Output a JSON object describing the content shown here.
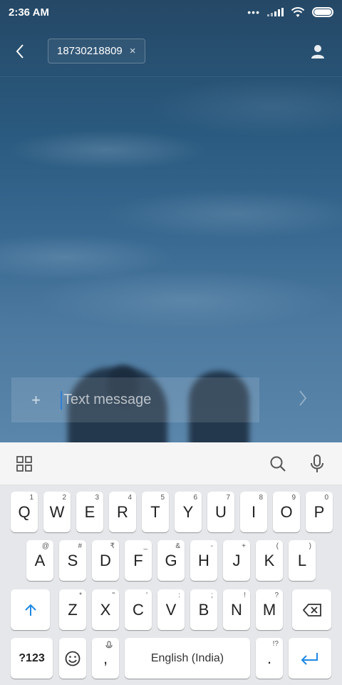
{
  "status_bar": {
    "time": "2:36 AM",
    "dots": "•••"
  },
  "header": {
    "recipient": "18730218809",
    "remove_symbol": "×"
  },
  "compose": {
    "attach_symbol": "+",
    "placeholder": "Text message"
  },
  "colors": {
    "accent": "#2f7fd6",
    "keyboard_bg": "#e5e7ea",
    "toolbar_bg": "#f5f5f5"
  },
  "keyboard": {
    "row1": [
      {
        "label": "Q",
        "alt": "1"
      },
      {
        "label": "W",
        "alt": "2"
      },
      {
        "label": "E",
        "alt": "3"
      },
      {
        "label": "R",
        "alt": "4"
      },
      {
        "label": "T",
        "alt": "5"
      },
      {
        "label": "Y",
        "alt": "6"
      },
      {
        "label": "U",
        "alt": "7"
      },
      {
        "label": "I",
        "alt": "8"
      },
      {
        "label": "O",
        "alt": "9"
      },
      {
        "label": "P",
        "alt": "0"
      }
    ],
    "row2": [
      {
        "label": "A",
        "alt": "@"
      },
      {
        "label": "S",
        "alt": "#"
      },
      {
        "label": "D",
        "alt": "₹"
      },
      {
        "label": "F",
        "alt": "_"
      },
      {
        "label": "G",
        "alt": "&"
      },
      {
        "label": "H",
        "alt": "-"
      },
      {
        "label": "J",
        "alt": "+"
      },
      {
        "label": "K",
        "alt": "("
      },
      {
        "label": "L",
        "alt": ")"
      }
    ],
    "row3": [
      {
        "label": "Z",
        "alt": "*"
      },
      {
        "label": "X",
        "alt": "\""
      },
      {
        "label": "C",
        "alt": "'"
      },
      {
        "label": "V",
        "alt": ":"
      },
      {
        "label": "B",
        "alt": ";"
      },
      {
        "label": "N",
        "alt": "!"
      },
      {
        "label": "M",
        "alt": "?"
      }
    ],
    "symbols_label": "?123",
    "comma_label": ",",
    "space_label": "English (India)",
    "period_label": ".",
    "period_alt": "!?",
    "icons": {
      "shift": "shift-arrow-icon",
      "backspace": "backspace-icon",
      "emoji": "emoji-icon",
      "mic": "microphone-icon",
      "enter": "enter-icon"
    }
  }
}
